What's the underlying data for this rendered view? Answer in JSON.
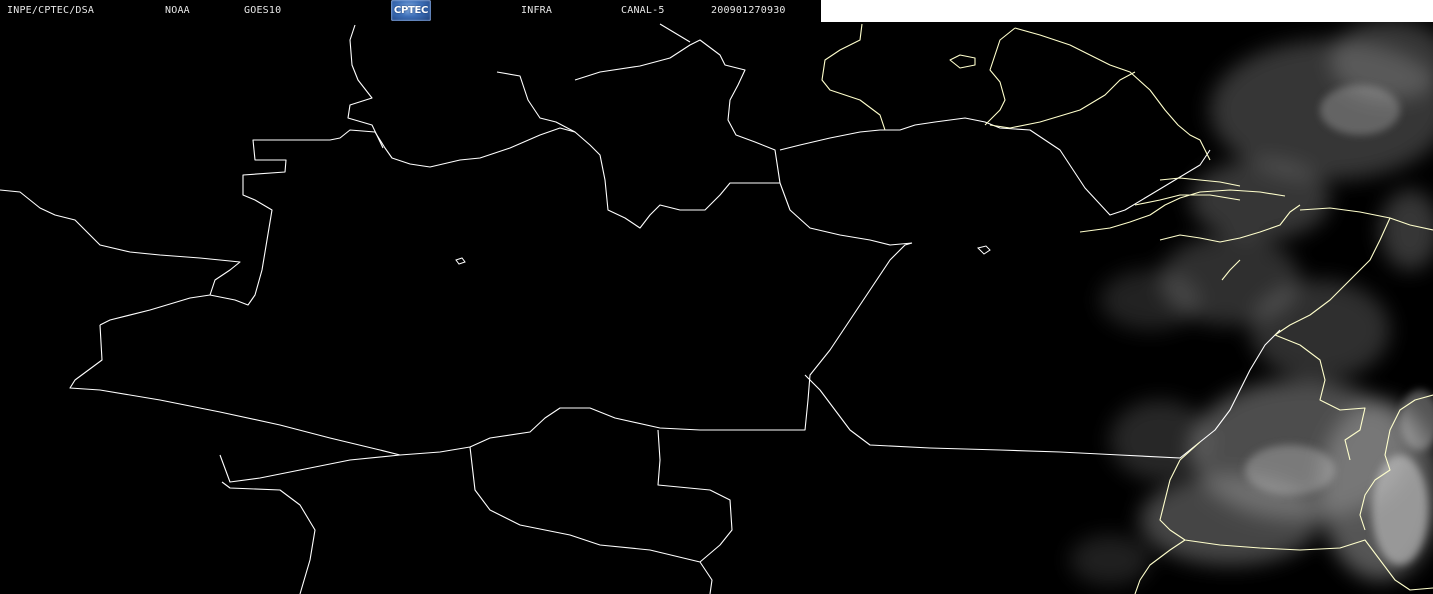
{
  "header": {
    "institution": "INPE/CPTEC/DSA",
    "agency": "NOAA",
    "satellite": "GOES10",
    "logo_text": "CPTEC",
    "product": "INFRA",
    "channel": "CANAL-5",
    "timestamp": "200901270930"
  },
  "colors": {
    "background": "#000000",
    "border_line": "#ffffff",
    "coast_line": "#ffffcc",
    "header_text": "#e8e8e8",
    "header_strip": "#ffffff",
    "cloud": "#bfbfbf"
  }
}
